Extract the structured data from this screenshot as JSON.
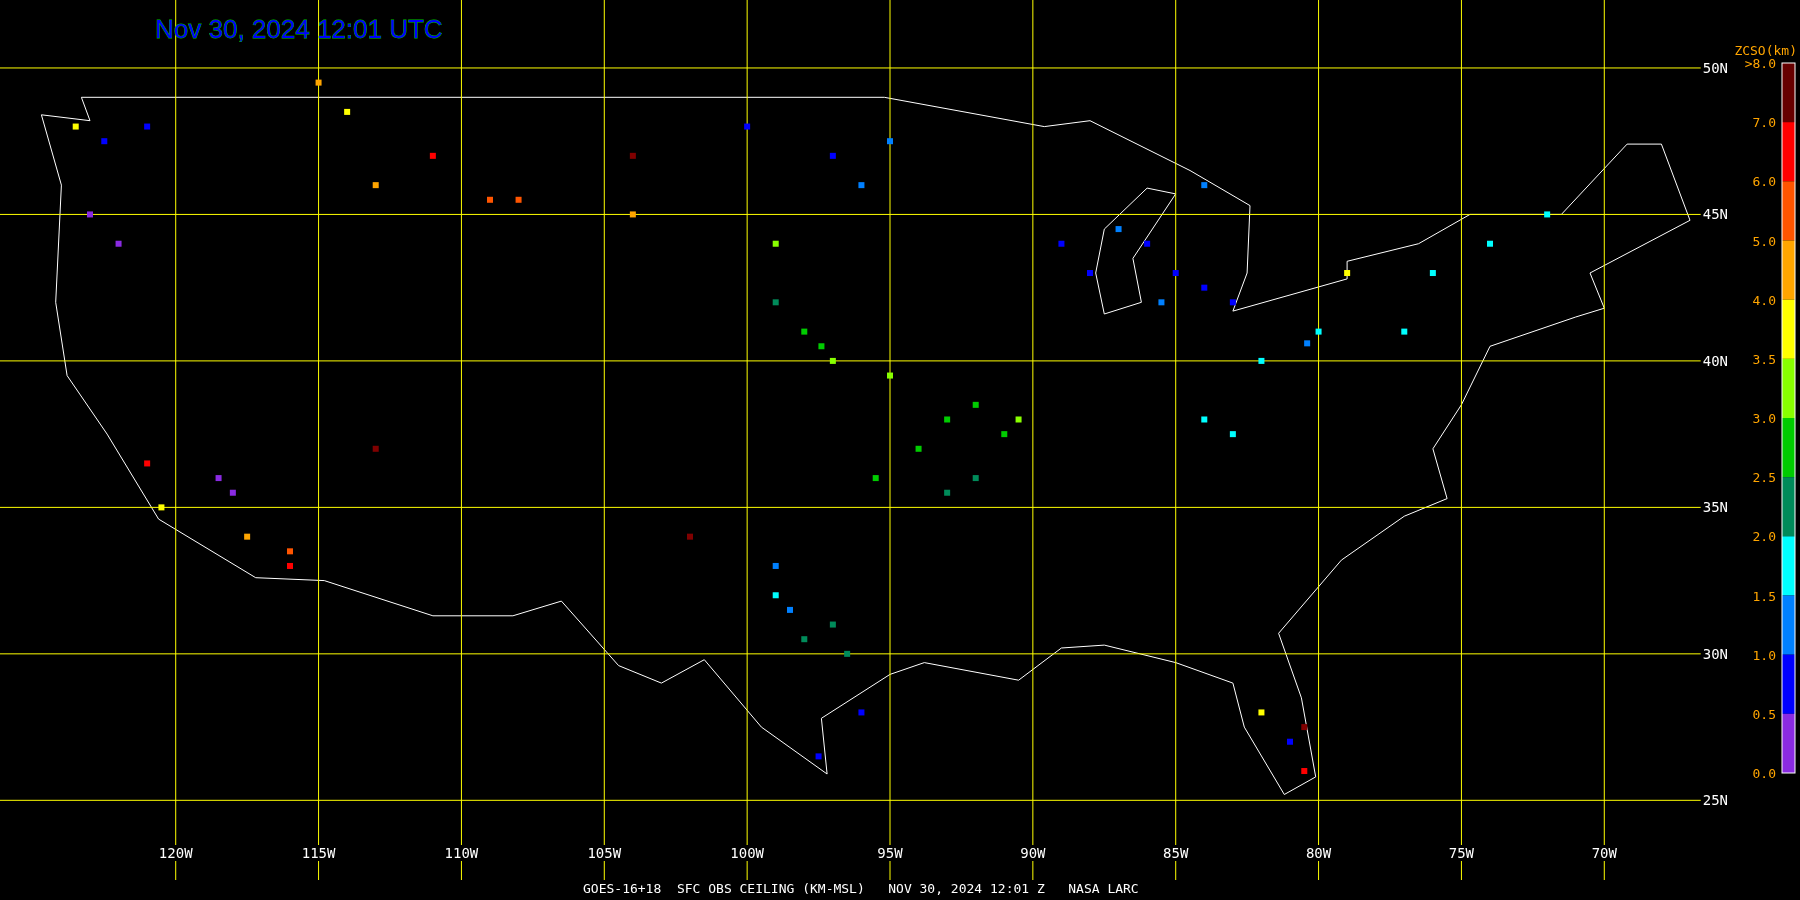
{
  "title": "Nov 30, 2024 12:01 UTC",
  "map": {
    "chart_data": {
      "type": "scatter",
      "grid": true,
      "xlim": [
        -126.15,
        -65.6
      ],
      "ylim": [
        22.28,
        52.32
      ],
      "xticks": [
        {
          "value": -120,
          "label": "120W"
        },
        {
          "value": -115,
          "label": "115W"
        },
        {
          "value": -110,
          "label": "110W"
        },
        {
          "value": -105,
          "label": "105W"
        },
        {
          "value": -100,
          "label": "100W"
        },
        {
          "value": -95,
          "label": "95W"
        },
        {
          "value": -90,
          "label": "90W"
        },
        {
          "value": -85,
          "label": "85W"
        },
        {
          "value": -80,
          "label": "80W"
        },
        {
          "value": -75,
          "label": "75W"
        },
        {
          "value": -70,
          "label": "70W"
        }
      ],
      "yticks": [
        {
          "value": 50,
          "label": "50N"
        },
        {
          "value": 45,
          "label": "45N"
        },
        {
          "value": 40,
          "label": "40N"
        },
        {
          "value": 35,
          "label": "35N"
        },
        {
          "value": 30,
          "label": "30N"
        },
        {
          "value": 25,
          "label": "25N"
        }
      ],
      "series": [
        {
          "color": "#8a2be2",
          "x": [
            -123,
            -122,
            -118.5,
            -118
          ],
          "values": [
            45,
            44,
            36,
            35.5
          ]
        },
        {
          "color": "#0000ff",
          "x": [
            -122.5,
            -121,
            -100,
            -97,
            -85,
            -84,
            -86,
            -83,
            -89,
            -88,
            -96,
            -97.5,
            -81
          ],
          "values": [
            47.5,
            48,
            48,
            47,
            43,
            42.5,
            44,
            42,
            44,
            43,
            28,
            26.5,
            27
          ]
        },
        {
          "color": "#0080ff",
          "x": [
            -95,
            -96,
            -87,
            -85.5,
            -84,
            -80.4,
            -99,
            -98.5
          ],
          "values": [
            47.5,
            46,
            44.5,
            42,
            46,
            40.6,
            33,
            31.5
          ]
        },
        {
          "color": "#00ffff",
          "x": [
            -82,
            -80,
            -77,
            -76,
            -74,
            -72,
            -84,
            -83,
            -99
          ],
          "values": [
            40,
            41,
            41,
            43,
            44,
            45,
            38,
            37.5,
            32
          ]
        },
        {
          "color": "#008b5a",
          "x": [
            -99,
            -97,
            -96.5,
            -98,
            -93,
            -92
          ],
          "values": [
            42,
            31,
            30,
            30.5,
            35.5,
            36
          ]
        },
        {
          "color": "#00cc00",
          "x": [
            -98,
            -93,
            -92,
            -94,
            -91,
            -97.4,
            -95.5
          ],
          "values": [
            41,
            38,
            38.5,
            37,
            37.5,
            40.5,
            36
          ]
        },
        {
          "color": "#88ff00",
          "x": [
            -97,
            -95,
            -99,
            -90.5
          ],
          "values": [
            40,
            39.5,
            44,
            38
          ]
        },
        {
          "color": "#ffff00",
          "x": [
            -114,
            -123.5,
            -82,
            -120.5,
            -79
          ],
          "values": [
            48.5,
            48,
            28,
            35,
            43
          ]
        },
        {
          "color": "#ffa500",
          "x": [
            -113,
            -117.5,
            -115,
            -104
          ],
          "values": [
            46,
            34,
            49.5,
            45
          ]
        },
        {
          "color": "#ff5500",
          "x": [
            -108,
            -109,
            -116
          ],
          "values": [
            45.5,
            45.5,
            33.5
          ]
        },
        {
          "color": "#ff0000",
          "x": [
            -111,
            -121,
            -80.5,
            -116
          ],
          "values": [
            47,
            36.5,
            26,
            33
          ]
        },
        {
          "color": "#800000",
          "x": [
            -104,
            -113,
            -102,
            -80.5
          ],
          "values": [
            47,
            37,
            34,
            27.5
          ]
        }
      ]
    }
  },
  "legend": {
    "title": "ZCSO(km)",
    "tick_labels": [
      ">8.0",
      "7.0",
      "6.0",
      "5.0",
      "4.0",
      "3.5",
      "3.0",
      "2.5",
      "2.0",
      "1.5",
      "1.0",
      "0.5",
      "0.0"
    ],
    "bins": [
      {
        "color": "#660000"
      },
      {
        "color": "#ff0000"
      },
      {
        "color": "#ff5500"
      },
      {
        "color": "#ffa500"
      },
      {
        "color": "#ffff00"
      },
      {
        "color": "#88ff00"
      },
      {
        "color": "#00cc00"
      },
      {
        "color": "#008b5a"
      },
      {
        "color": "#00ffff"
      },
      {
        "color": "#0080ff"
      },
      {
        "color": "#0000ff"
      },
      {
        "color": "#8a2be2"
      }
    ]
  },
  "caption": "GOES-16+18  SFC OBS CEILING (KM-MSL)   NOV 30, 2024 12:01 Z   NASA LARC"
}
